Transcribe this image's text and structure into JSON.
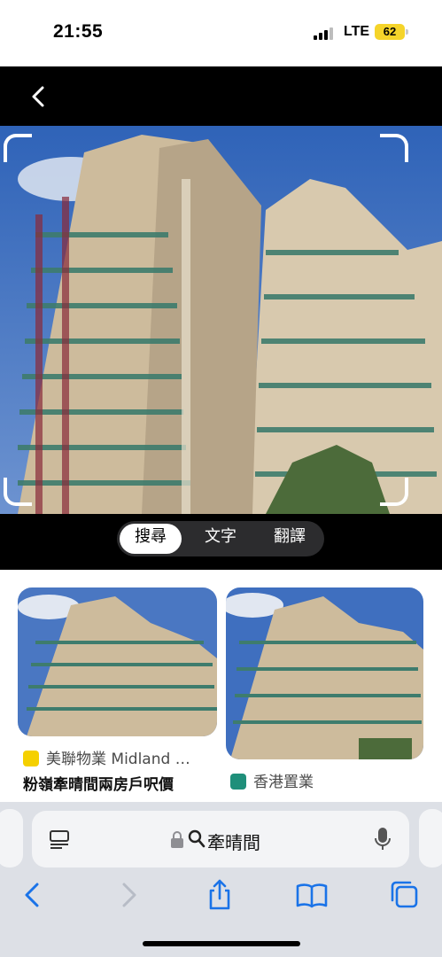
{
  "status_bar": {
    "time": "21:55",
    "network": "LTE",
    "battery": "62"
  },
  "lens": {
    "segments": [
      {
        "label": "搜尋",
        "active": true
      },
      {
        "label": "文字",
        "active": false
      },
      {
        "label": "翻譯",
        "active": false
      }
    ]
  },
  "results": [
    {
      "source": "美聯物業 Midland …",
      "title": "粉嶺牽晴間兩房戶呎價"
    },
    {
      "source": "香港置業",
      "title": ""
    }
  ],
  "address_bar": {
    "query": "牽晴間"
  },
  "colors": {
    "accent": "#1a73e8",
    "midland_badge": "#f5d000",
    "hkp_badge": "#1f8f7a"
  }
}
